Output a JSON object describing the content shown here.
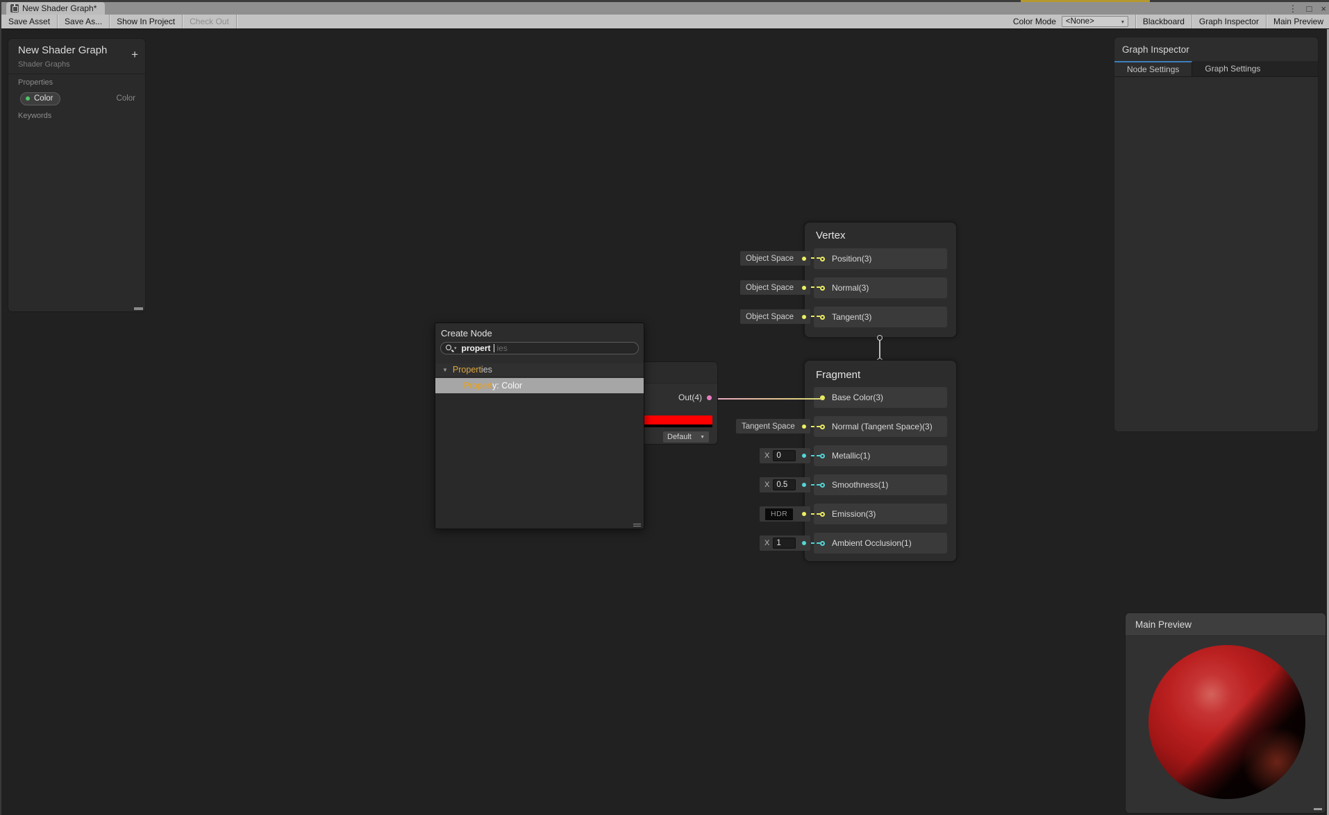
{
  "window": {
    "tab_title": "New Shader Graph*",
    "controls": {
      "menu": "⋮",
      "maximize": "□",
      "close": "×"
    }
  },
  "toolbar": {
    "buttons_left": [
      "Save Asset",
      "Save As...",
      "Show In Project",
      "Check Out"
    ],
    "color_mode_label": "Color Mode",
    "color_mode_value": "<None>",
    "dropdown_arrow": "▾",
    "buttons_right": [
      "Blackboard",
      "Graph Inspector",
      "Main Preview"
    ]
  },
  "blackboard": {
    "title": "New Shader Graph",
    "subtitle": "Shader Graphs",
    "add_button": "+",
    "properties_label": "Properties",
    "keywords_label": "Keywords",
    "property_pill": {
      "name": "Color",
      "type": "Color"
    }
  },
  "create_node_dialog": {
    "title": "Create Node",
    "search": {
      "typed": "propert",
      "completion": "ies"
    },
    "group_header": {
      "match": "Propert",
      "rest": "ies",
      "arrow": "▼"
    },
    "selected_item": {
      "match": "Propert",
      "rest": "y: Color"
    }
  },
  "color_node": {
    "output_label": "Out(4)",
    "swatch_color": "#ff0000",
    "mode_dropdown": "Default",
    "dropdown_arrow": "▼"
  },
  "vertex_node": {
    "title": "Vertex",
    "rows": [
      {
        "space": "Object Space",
        "label": "Position(3)"
      },
      {
        "space": "Object Space",
        "label": "Normal(3)"
      },
      {
        "space": "Object Space",
        "label": "Tangent(3)"
      }
    ]
  },
  "fragment_node": {
    "title": "Fragment",
    "rows": [
      {
        "label": "Base Color(3)"
      },
      {
        "space": "Tangent Space",
        "label": "Normal (Tangent Space)(3)"
      },
      {
        "x": "X",
        "value": "0",
        "label": "Metallic(1)"
      },
      {
        "x": "X",
        "value": "0.5",
        "label": "Smoothness(1)"
      },
      {
        "badge": "HDR",
        "label": "Emission(3)"
      },
      {
        "x": "X",
        "value": "1",
        "label": "Ambient Occlusion(1)"
      }
    ]
  },
  "graph_inspector": {
    "title": "Graph Inspector",
    "tabs": [
      "Node Settings",
      "Graph Settings"
    ]
  },
  "main_preview": {
    "title": "Main Preview"
  },
  "colors": {
    "accent_blue": "#3c7ebc",
    "swatch_red": "#ff0000",
    "port_vector3_yellow": "#eef05f",
    "port_float_cyan": "#54d6d6",
    "port_vector4_pink": "#ef7fc7",
    "search_match_yellow": "#dfa73e",
    "property_dot_green": "#52c36a",
    "top_accent_strip": "#b5992e"
  }
}
